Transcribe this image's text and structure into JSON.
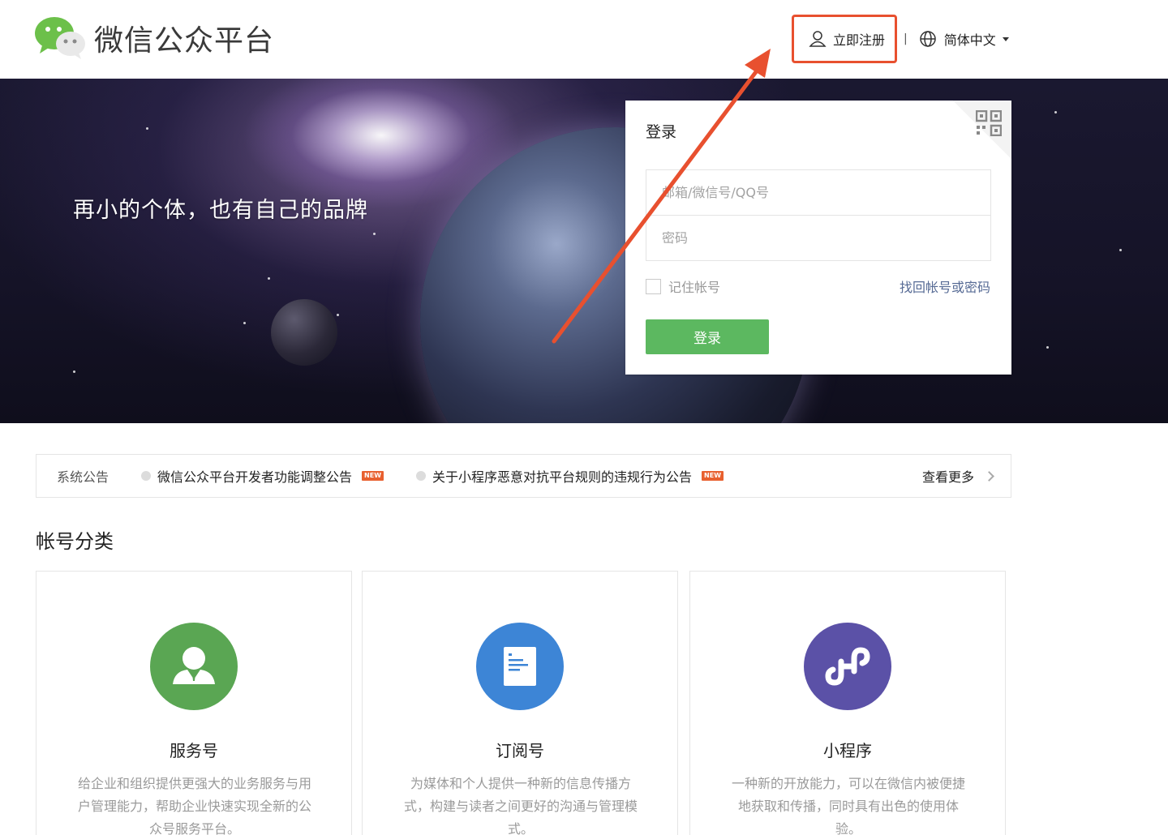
{
  "header": {
    "logo_text": "微信公众平台",
    "register_label": "立即注册",
    "separator": "|",
    "language_label": "简体中文"
  },
  "banner": {
    "slogan": "再小的个体，也有自己的品牌"
  },
  "login": {
    "title": "登录",
    "account_placeholder": "邮箱/微信号/QQ号",
    "password_placeholder": "密码",
    "remember_label": "记住帐号",
    "forgot_label": "找回帐号或密码",
    "submit_label": "登录"
  },
  "notices": {
    "label": "系统公告",
    "items": [
      {
        "text": "微信公众平台开发者功能调整公告",
        "badge": "NEW"
      },
      {
        "text": "关于小程序恶意对抗平台规则的违规行为公告",
        "badge": "NEW"
      }
    ],
    "more_label": "查看更多"
  },
  "categories": {
    "title": "帐号分类",
    "cards": [
      {
        "name": "服务号",
        "desc": "给企业和组织提供更强大的业务服务与用户管理能力，帮助企业快速实现全新的公众号服务平台。",
        "color": "#5aa653",
        "icon": "person-icon"
      },
      {
        "name": "订阅号",
        "desc": "为媒体和个人提供一种新的信息传播方式，构建与读者之间更好的沟通与管理模式。",
        "color": "#3d85d6",
        "icon": "document-icon"
      },
      {
        "name": "小程序",
        "desc": "一种新的开放能力，可以在微信内被便捷地获取和传播，同时具有出色的使用体验。",
        "color": "#5b51a7",
        "icon": "miniprogram-icon"
      }
    ]
  },
  "colors": {
    "accent_green": "#5cb860",
    "link_blue": "#576b95",
    "annotation_red": "#e8502f"
  }
}
